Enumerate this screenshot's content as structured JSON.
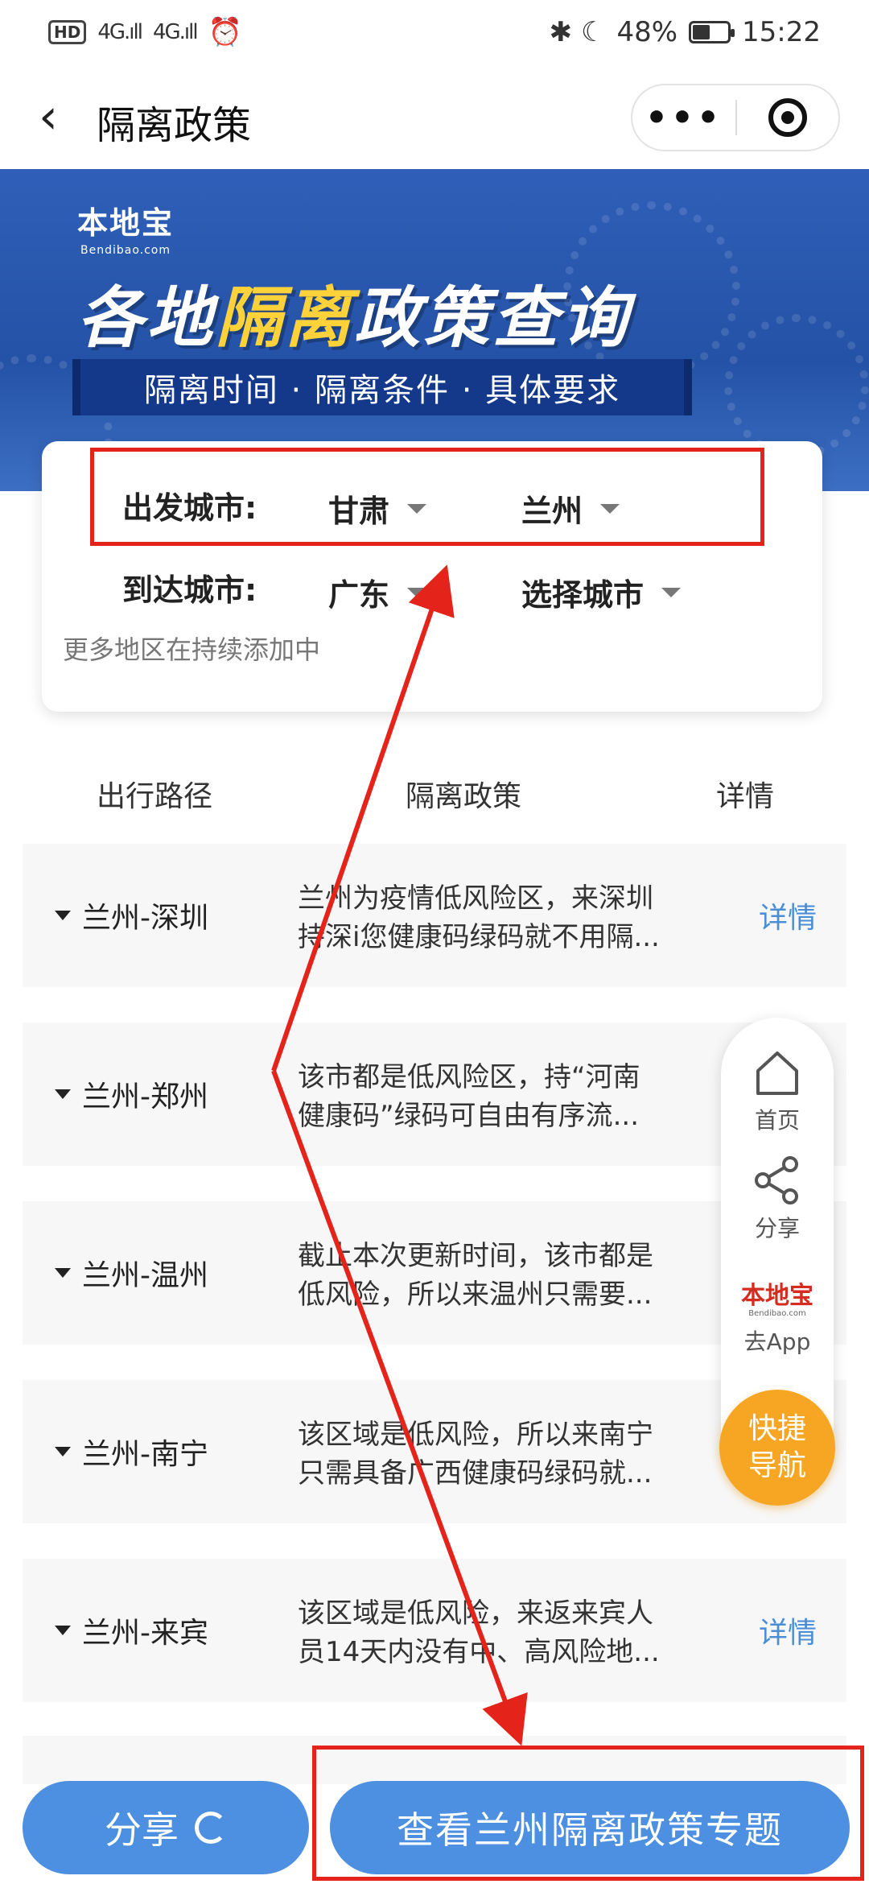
{
  "status_bar": {
    "left_badge": "HD",
    "left_sub": "1",
    "signal1": "4G.ıll",
    "signal2": "4G.ıll",
    "right_icons": "✱ ☾",
    "battery_pct_label": "48%",
    "battery_level": 0.48,
    "time": "15:22"
  },
  "nav": {
    "title": "隔离政策",
    "back": "‹",
    "more": "•••"
  },
  "banner": {
    "brand_name": "本地宝",
    "brand_sub": "Bendibao.com",
    "title_pre": "各地",
    "title_highlight": "隔离",
    "title_post": "政策查询",
    "subtitle": "隔离时间 · 隔离条件 · 具体要求"
  },
  "selector": {
    "depart_label": "出发城市:",
    "depart_province": "甘肃",
    "depart_city": "兰州",
    "arrive_label": "到达城市:",
    "arrive_province": "广东",
    "arrive_city": "选择城市",
    "note": "更多地区在持续添加中"
  },
  "table": {
    "headers": [
      "出行路径",
      "隔离政策",
      "详情"
    ],
    "rows": [
      {
        "route": "兰州-深圳",
        "policy_line1": "兰州为疫情低风险区，来深圳",
        "policy_line2": "持深i您健康码绿码就不用隔...",
        "detail": "详情"
      },
      {
        "route": "兰州-郑州",
        "policy_line1": "该市都是低风险区，持“河南",
        "policy_line2": "健康码”绿码可自由有序流...",
        "detail": ""
      },
      {
        "route": "兰州-温州",
        "policy_line1": "截止本次更新时间，该市都是",
        "policy_line2": "低风险，所以来温州只需要...",
        "detail": ""
      },
      {
        "route": "兰州-南宁",
        "policy_line1": "该区域是低风险，所以来南宁",
        "policy_line2": "只需具备广西健康码绿码就...",
        "detail": ""
      },
      {
        "route": "兰州-来宾",
        "policy_line1": "该区域是低风险，来返来宾人",
        "policy_line2": "员14天内没有中、高风险地...",
        "detail": "详情"
      }
    ]
  },
  "float_nav": {
    "home": "首页",
    "share": "分享",
    "app_logo": "本地宝",
    "app_logo_sub": "Bendibao.com",
    "app": "去App",
    "quick_line1": "快捷",
    "quick_line2": "导航"
  },
  "bottom": {
    "share_label": "分享",
    "view_label": "查看兰州隔离政策专题"
  },
  "colors": {
    "accent_blue": "#4d8fe0",
    "detail_link": "#4a8fd6",
    "annotation_red": "#e4241b",
    "quick_nav_orange": "#f6a623",
    "banner_highlight": "#ffd23a"
  }
}
